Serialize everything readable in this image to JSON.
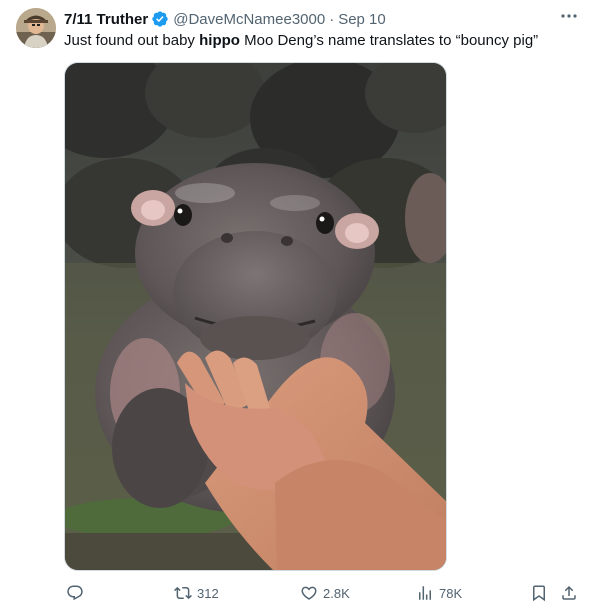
{
  "tweet": {
    "display_name": "7/11 Truther",
    "handle": "@DaveMcNamee3000",
    "separator": "·",
    "date": "Sep 10",
    "text_before": "Just found out baby ",
    "text_bold": "hippo",
    "text_after": " Moo Deng’s name translates to “bouncy pig”"
  },
  "actions": {
    "replies": "",
    "reposts": "312",
    "likes": "2.8K",
    "views": "78K"
  },
  "icons": {
    "verified": "verified-badge-icon",
    "more": "more-options-icon",
    "reply": "reply-icon",
    "repost": "repost-icon",
    "like": "heart-icon",
    "views": "views-chart-icon",
    "bookmark": "bookmark-icon",
    "share": "share-icon"
  },
  "colors": {
    "verified_blue": "#1d9bf0",
    "muted_text": "#536471"
  }
}
